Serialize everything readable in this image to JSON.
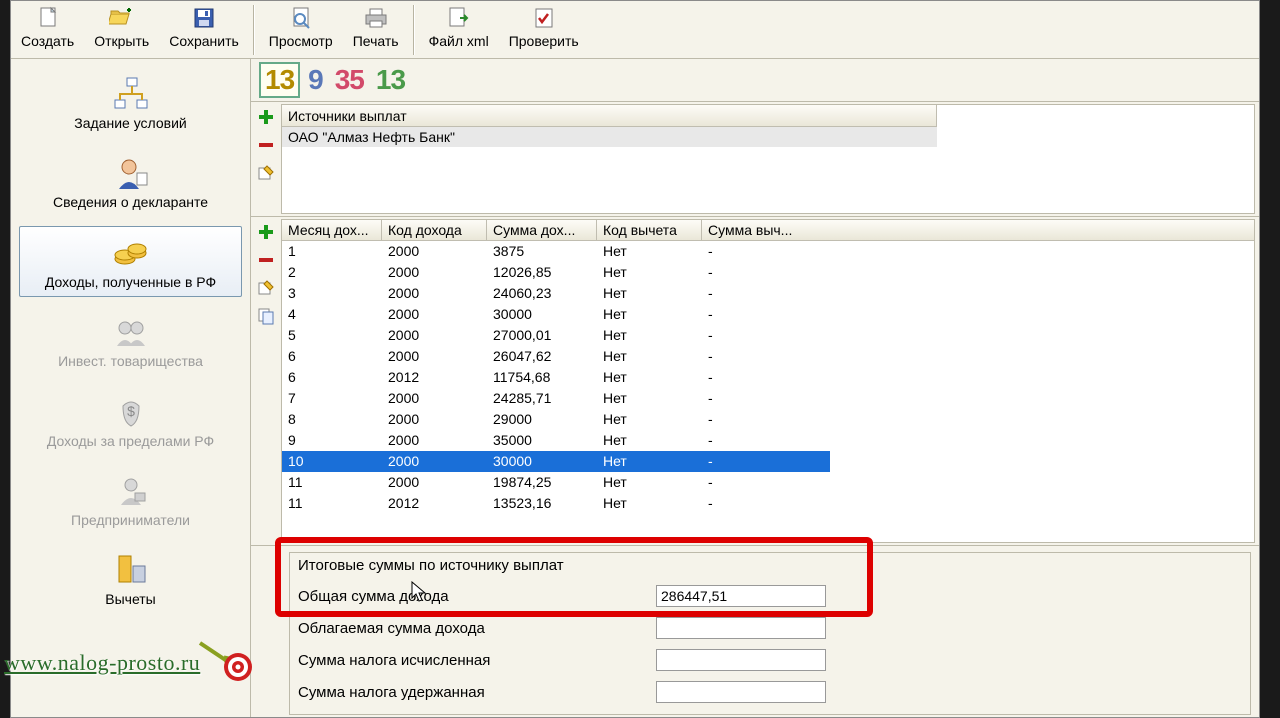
{
  "toolbar": {
    "create": "Создать",
    "open": "Открыть",
    "save": "Сохранить",
    "preview": "Просмотр",
    "print": "Печать",
    "file_xml": "Файл xml",
    "check": "Проверить"
  },
  "nav": {
    "conditions": "Задание условий",
    "declarant": "Сведения о декларанте",
    "income_rf": "Доходы, полученные в РФ",
    "invest": "Инвест. товарищества",
    "income_abroad": "Доходы за пределами РФ",
    "entrepreneurs": "Предприниматели",
    "deductions": "Вычеты"
  },
  "page_numbers": [
    "13",
    "9",
    "35",
    "13"
  ],
  "sources": {
    "header": "Источники выплат",
    "row": "ОАО \"Алмаз Нефть Банк\""
  },
  "income_table": {
    "headers": {
      "month": "Месяц дох...",
      "code": "Код дохода",
      "sum": "Сумма дох...",
      "ded_code": "Код вычета",
      "ded_sum": "Сумма выч..."
    },
    "rows": [
      {
        "m": "1",
        "kd": "2000",
        "sd": "3875",
        "kv": "Нет",
        "sv": "-"
      },
      {
        "m": "2",
        "kd": "2000",
        "sd": "12026,85",
        "kv": "Нет",
        "sv": "-"
      },
      {
        "m": "3",
        "kd": "2000",
        "sd": "24060,23",
        "kv": "Нет",
        "sv": "-"
      },
      {
        "m": "4",
        "kd": "2000",
        "sd": "30000",
        "kv": "Нет",
        "sv": "-"
      },
      {
        "m": "5",
        "kd": "2000",
        "sd": "27000,01",
        "kv": "Нет",
        "sv": "-"
      },
      {
        "m": "6",
        "kd": "2000",
        "sd": "26047,62",
        "kv": "Нет",
        "sv": "-"
      },
      {
        "m": "6",
        "kd": "2012",
        "sd": "11754,68",
        "kv": "Нет",
        "sv": "-"
      },
      {
        "m": "7",
        "kd": "2000",
        "sd": "24285,71",
        "kv": "Нет",
        "sv": "-"
      },
      {
        "m": "8",
        "kd": "2000",
        "sd": "29000",
        "kv": "Нет",
        "sv": "-"
      },
      {
        "m": "9",
        "kd": "2000",
        "sd": "35000",
        "kv": "Нет",
        "sv": "-"
      },
      {
        "m": "10",
        "kd": "2000",
        "sd": "30000",
        "kv": "Нет",
        "sv": "-",
        "sel": true
      },
      {
        "m": "11",
        "kd": "2000",
        "sd": "19874,25",
        "kv": "Нет",
        "sv": "-"
      },
      {
        "m": "11",
        "kd": "2012",
        "sd": "13523,16",
        "kv": "Нет",
        "sv": "-"
      }
    ]
  },
  "totals": {
    "title": "Итоговые суммы по источнику выплат",
    "total_income_label": "Общая сумма дохода",
    "total_income_value": "286447,51",
    "taxable_income_label": "Облагаемая сумма дохода",
    "taxable_income_value": "",
    "tax_calculated_label": "Сумма налога исчисленная",
    "tax_calculated_value": "",
    "tax_withheld_label": "Сумма налога удержанная",
    "tax_withheld_value": ""
  },
  "watermark": "www.nalog-prosto.ru"
}
